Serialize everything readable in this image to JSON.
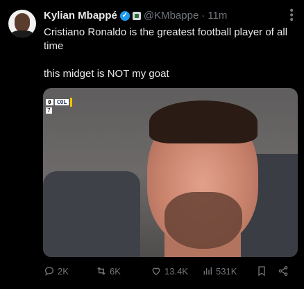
{
  "tweet": {
    "author_name": "Kylian Mbappé",
    "handle": "@KMbappe",
    "separator": "·",
    "time": "11m",
    "line1": "Cristiano Ronaldo is the greatest football player of all time",
    "line2": "this midget is NOT my goat"
  },
  "media": {
    "score": "0",
    "team": "COL",
    "sub_value": "7"
  },
  "actions": {
    "replies": "2K",
    "reposts": "6K",
    "likes": "13.4K",
    "views": "531K"
  },
  "colors": {
    "background": "#000000",
    "text": "#e7e9ea",
    "muted": "#71767b",
    "verified": "#1d9bf0"
  }
}
